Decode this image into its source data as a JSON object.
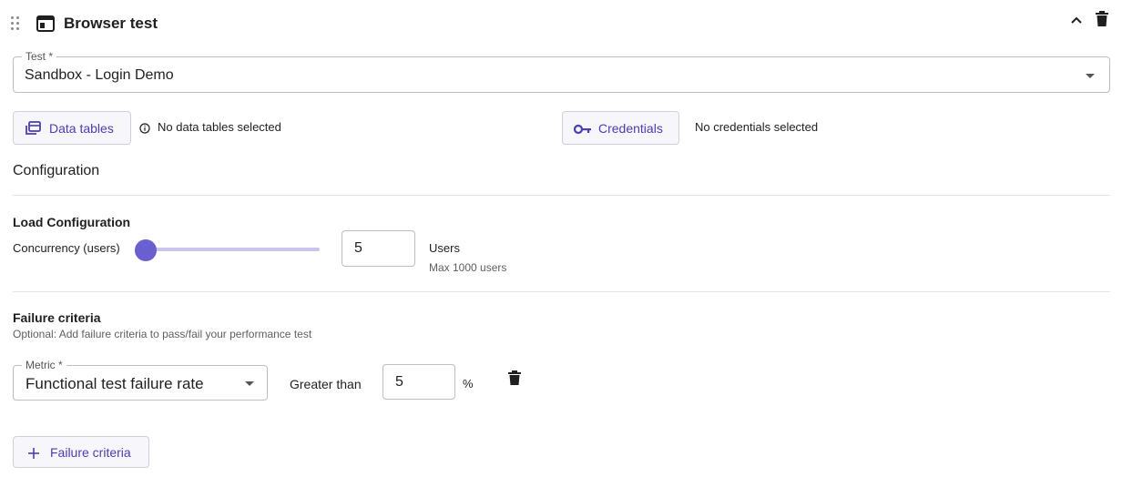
{
  "header": {
    "title": "Browser test",
    "drag_icon": "drag-handle-icon",
    "window_icon": "browser-window-icon",
    "collapse_icon": "chevron-up-icon",
    "delete_icon": "trash-icon"
  },
  "test_field": {
    "label": "Test *",
    "value": "Sandbox - Login Demo"
  },
  "data_tables": {
    "button_label": "Data tables",
    "status": "No data tables selected",
    "icon": "data-tables-icon",
    "info_icon": "info-icon"
  },
  "credentials": {
    "button_label": "Credentials",
    "status": "No credentials selected",
    "icon": "key-icon"
  },
  "configuration": {
    "heading": "Configuration"
  },
  "load_configuration": {
    "heading": "Load Configuration",
    "concurrency_label": "Concurrency (users)",
    "concurrency_value": "5",
    "slider_fraction": 0.005,
    "unit_label": "Users",
    "max_hint": "Max 1000 users"
  },
  "failure_criteria": {
    "heading": "Failure criteria",
    "description": "Optional: Add failure criteria to pass/fail your performance test",
    "metric_label": "Metric *",
    "metric_value": "Functional test failure rate",
    "comparator": "Greater than",
    "threshold_value": "5",
    "threshold_unit": "%",
    "add_button_label": "Failure criteria",
    "add_icon": "plus-icon"
  },
  "colors": {
    "accent": "#6a5fcf",
    "accent_text": "#4a3fb0",
    "border": "#bdbdbd",
    "divider": "#e3e3e3"
  }
}
